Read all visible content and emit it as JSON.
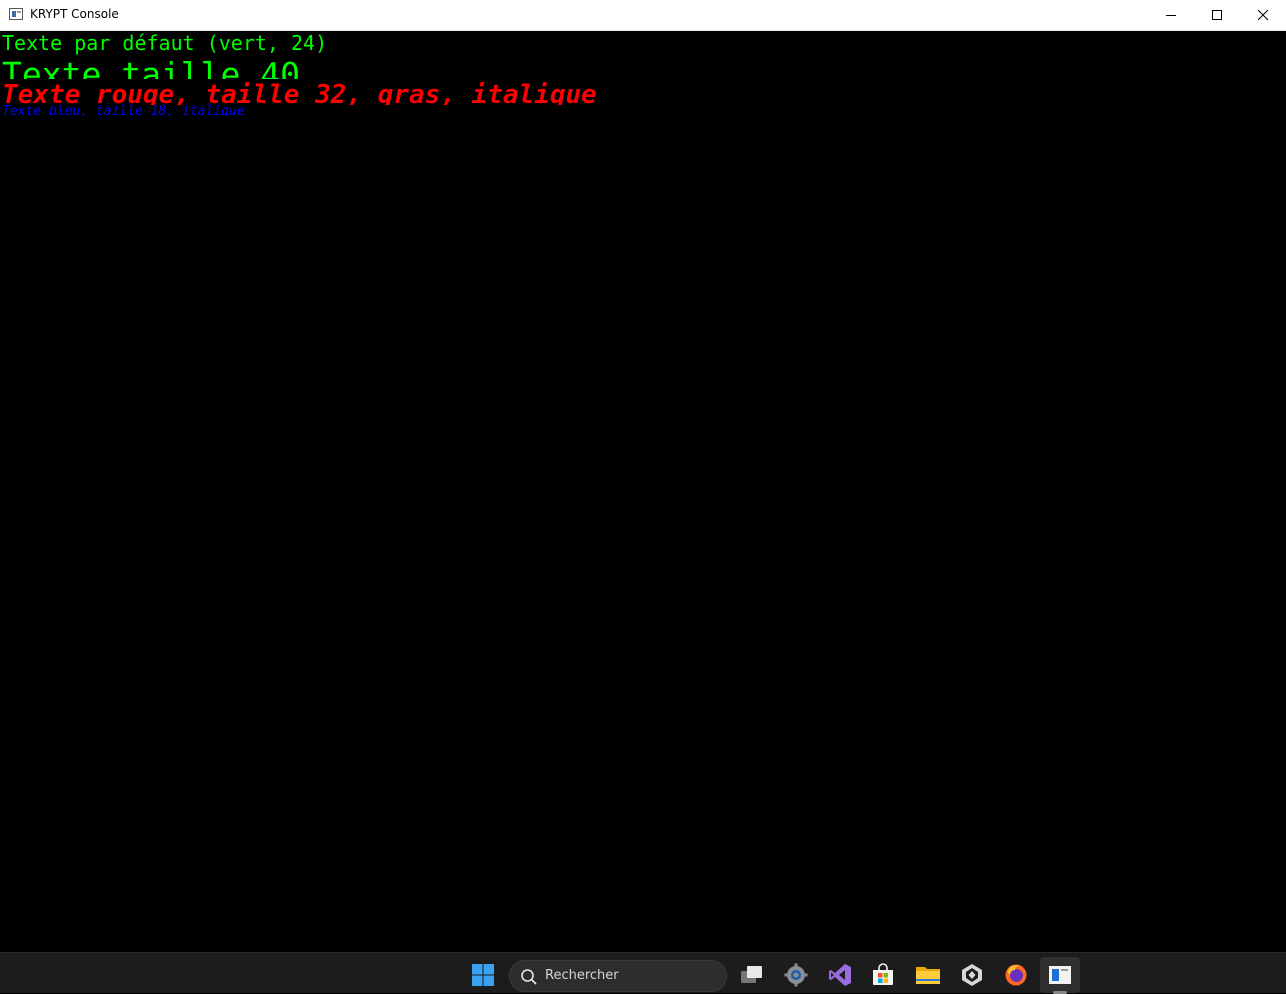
{
  "window": {
    "title": "KRYPT Console"
  },
  "console": {
    "lines": [
      {
        "text": "Texte par défaut (vert, 24)",
        "color": "#00ff00"
      },
      {
        "text": "Texte taille 40",
        "color": "#00ff00"
      },
      {
        "text": "Texte rouge, taille 32, gras, italique",
        "color": "#ff0000"
      },
      {
        "text": "Texte bleu, taille 18, italique",
        "color": "#0000ff"
      }
    ]
  },
  "taskbar": {
    "search_placeholder": "Rechercher",
    "icons": [
      "windows-start-icon",
      "search-icon",
      "task-view-icon",
      "settings-icon",
      "visual-studio-icon",
      "microsoft-store-icon",
      "file-explorer-icon",
      "unity-icon",
      "firefox-icon",
      "krypt-console-icon"
    ]
  }
}
